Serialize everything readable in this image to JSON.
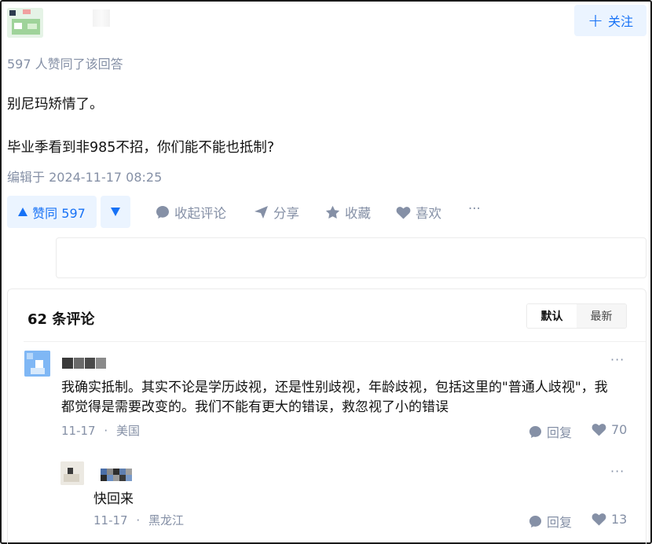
{
  "header": {
    "follow_label": "关注"
  },
  "answer": {
    "agree_line": "597 人赞同了该回答",
    "paragraphs": [
      "别尼玛矫情了。",
      "毕业季看到非985不招，你们能不能也抵制?"
    ],
    "edited": "编辑于 2024-11-17 08:25"
  },
  "actions": {
    "vote_up": "赞同 597",
    "comment": "收起评论",
    "share": "分享",
    "collect": "收藏",
    "like": "喜欢",
    "more": "···"
  },
  "comments": {
    "count_label": "62 条评论",
    "sort": {
      "default": "默认",
      "latest": "最新"
    },
    "items": [
      {
        "text": "我确实抵制。其实不论是学历歧视，还是性别歧视，年龄歧视，包括这里的\"普通人歧视\"，我都觉得是需要改变的。我们不能有更大的错误，救忽视了小的错误",
        "date": "11-17",
        "location": "美国",
        "reply": "回复",
        "likes": "70"
      },
      {
        "text": "快回来",
        "date": "11-17",
        "location": "黑龙江",
        "reply": "回复",
        "likes": "13"
      }
    ],
    "more": "···",
    "separator": "·"
  },
  "colors": {
    "accent": "#1772f6",
    "accent_bg": "#ebf4ff",
    "muted": "#8590a6"
  },
  "icons": [
    "plus-icon",
    "triangle-up-icon",
    "triangle-down-icon",
    "comment-icon",
    "share-icon",
    "star-icon",
    "heart-icon",
    "more-icon"
  ]
}
